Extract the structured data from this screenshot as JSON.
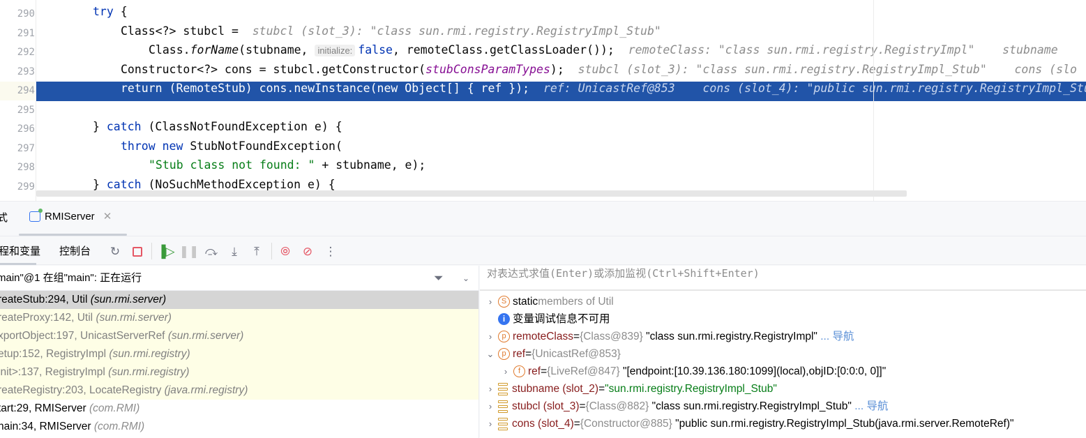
{
  "editor": {
    "line_numbers": [
      "290",
      "291",
      "292",
      "293",
      "294",
      "295",
      "296",
      "297",
      "298",
      "299"
    ],
    "current_line": "294",
    "lines": {
      "l0": {
        "kw": "try",
        "rest": " {"
      },
      "l1": {
        "code": "Class<?> stubcl = ",
        "hint": "stubcl (slot_3): \"class sun.rmi.registry.RegistryImpl_Stub\""
      },
      "l2": {
        "pre": "Class.",
        "method": "forName",
        "mid": "(stubname, ",
        "inlay": "initialize:",
        "kw": "false",
        "post": ", remoteClass.getClassLoader());",
        "hint": "remoteClass: \"class sun.rmi.registry.RegistryImpl\"    stubname"
      },
      "l3": {
        "pre": "Constructor<?> cons = stubcl.getConstructor(",
        "param": "stubConsParamTypes",
        "post": ");",
        "hint": "stubcl (slot_3): \"class sun.rmi.registry.RegistryImpl_Stub\"    cons (slo"
      },
      "l4": {
        "code": "return (RemoteStub) cons.newInstance(new Object[] { ref });",
        "hint": "ref: UnicastRef@853    cons (slot_4): \"public sun.rmi.registry.RegistryImpl_Stub"
      },
      "l6": {
        "pre": "} ",
        "kw": "catch",
        "post": " (ClassNotFoundException e) {"
      },
      "l7": {
        "kw1": "throw",
        "kw2": "new",
        "post": " StubNotFoundException("
      },
      "l8": {
        "str": "\"Stub class not found: \"",
        "post": " + stubname, e);"
      },
      "l9": {
        "pre": "} ",
        "kw": "catch",
        "post": " (NoSuchMethodException e) {"
      }
    }
  },
  "debug": {
    "left_tab_fragment": "式",
    "session_tab": "RMIServer",
    "tabs": {
      "frames_vars": "程和变量",
      "console": "控制台"
    },
    "thread": "main\"@1 在组\"main\": 正在运行",
    "frames": [
      {
        "method": "reateStub:294, Util",
        "pkg": "(sun.rmi.server)",
        "state": "selected"
      },
      {
        "method": "reateProxy:142, Util",
        "pkg": "(sun.rmi.server)",
        "state": "library"
      },
      {
        "method": "xportObject:197, UnicastServerRef",
        "pkg": "(sun.rmi.server)",
        "state": "library"
      },
      {
        "method": "etup:152, RegistryImpl",
        "pkg": "(sun.rmi.registry)",
        "state": "library"
      },
      {
        "method": "init>:137, RegistryImpl",
        "pkg": "(sun.rmi.registry)",
        "state": "library"
      },
      {
        "method": "reateRegistry:203, LocateRegistry",
        "pkg": "(java.rmi.registry)",
        "state": "library"
      },
      {
        "method": "tart:29, RMIServer",
        "pkg": "(com.RMI)",
        "state": "normal"
      },
      {
        "method": "nain:34, RMIServer",
        "pkg": "(com.RMI)",
        "state": "normal"
      }
    ],
    "eval_placeholder": "对表达式求值(Enter)或添加监视(Ctrl+Shift+Enter)",
    "variables": {
      "static": {
        "name": "static",
        "rest": " members of Util"
      },
      "info": "变量调试信息不可用",
      "remoteClass": {
        "name": "remoteClass",
        "type": "{Class@839}",
        "value": "\"class sun.rmi.registry.RegistryImpl\"",
        "nav": "... 导航"
      },
      "ref": {
        "name": "ref",
        "type": "{UnicastRef@853}"
      },
      "ref_inner": {
        "name": "ref",
        "type": "{LiveRef@847}",
        "value": "\"[endpoint:[10.39.136.180:1099](local),objID:[0:0:0, 0]]\""
      },
      "stubname": {
        "name": "stubname (slot_2)",
        "value": "\"sun.rmi.registry.RegistryImpl_Stub\""
      },
      "stubcl": {
        "name": "stubcl (slot_3)",
        "type": "{Class@882}",
        "value": "\"class sun.rmi.registry.RegistryImpl_Stub\"",
        "nav": "... 导航"
      },
      "cons": {
        "name": "cons (slot_4)",
        "type": "{Constructor@885}",
        "value": "\"public sun.rmi.registry.RegistryImpl_Stub(java.rmi.server.RemoteRef)\""
      }
    },
    "eq": " = "
  },
  "colors": {
    "highlight": "#2154a8",
    "keyword": "#0033b3",
    "string": "#067d17",
    "library_frame_bg": "#fefee6"
  }
}
